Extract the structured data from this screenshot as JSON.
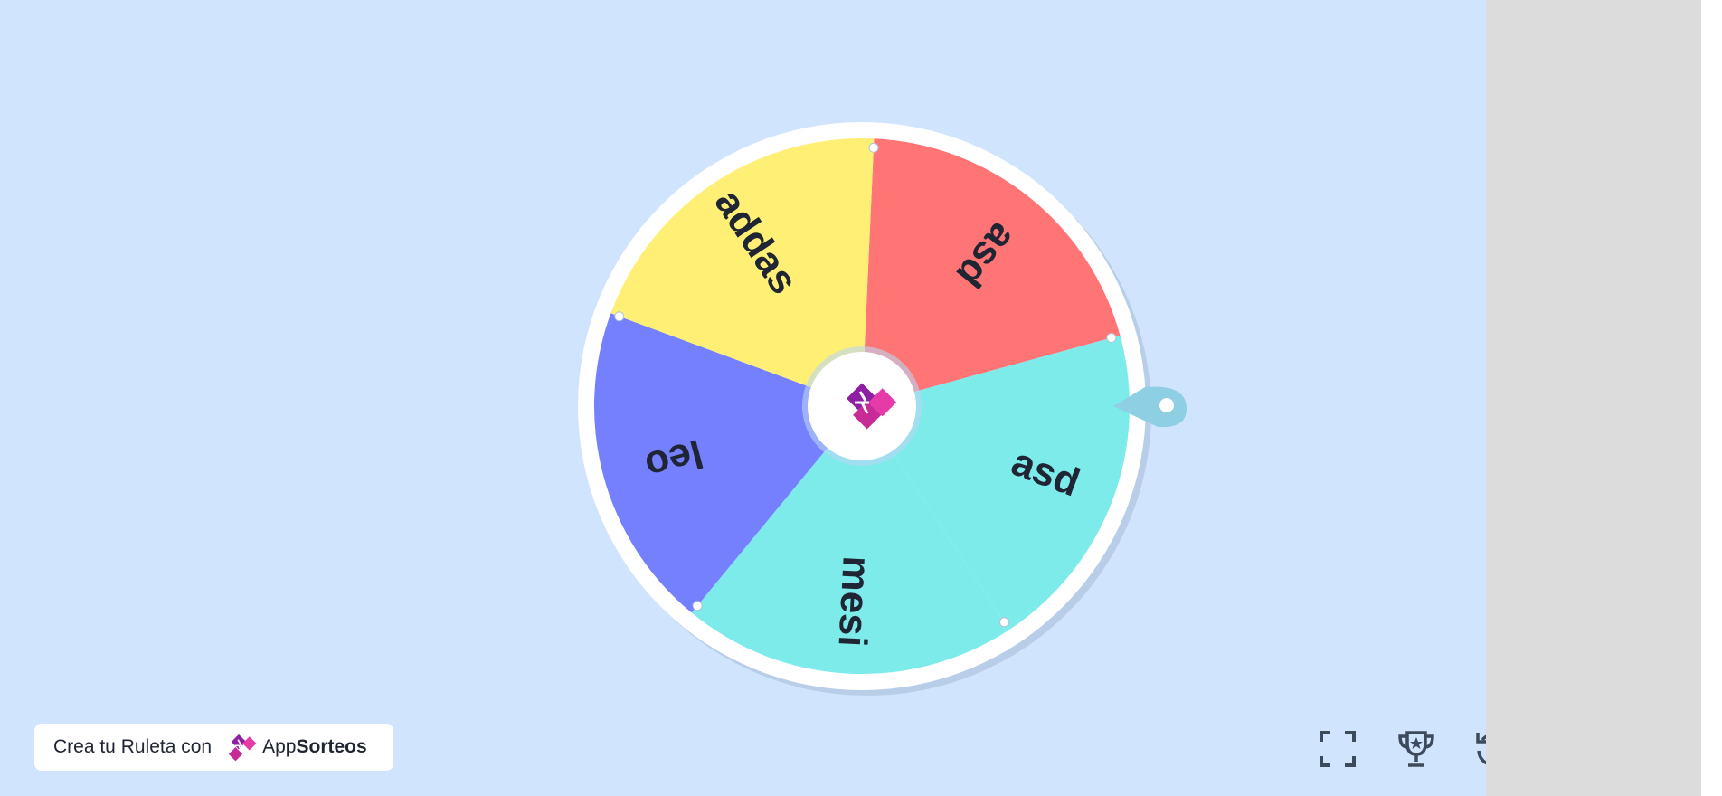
{
  "colors": {
    "background": "#d1e4fe",
    "side_panel": "#dcdcdc",
    "wheel_rim": "#ffffff",
    "pointer": "#8fcfe3",
    "icon": "#3d4a5c",
    "brand_purple": "#8e1fa3",
    "brand_pink": "#e63aa8"
  },
  "wheel": {
    "segments": [
      {
        "label": "asd",
        "color": "#ff7575"
      },
      {
        "label": "asd",
        "color": "#7eebeb"
      },
      {
        "label": "mesi",
        "color": "#7eebeb"
      },
      {
        "label": "leo",
        "color": "#7580ff"
      },
      {
        "label": "addas",
        "color": "#fff075"
      }
    ],
    "center_icon": "appsorteos-logo-icon",
    "pointer_icon": "wheel-pointer"
  },
  "brand_card": {
    "cta": "Crea tu Ruleta con",
    "brand_light": "App",
    "brand_bold": "Sorteos",
    "logo_icon": "appsorteos-logo-icon"
  },
  "controls": [
    {
      "name": "fullscreen-button",
      "icon": "fullscreen-icon"
    },
    {
      "name": "winners-button",
      "icon": "trophy-icon"
    },
    {
      "name": "reset-button",
      "icon": "reset-icon"
    },
    {
      "name": "sound-button",
      "icon": "speaker-icon"
    },
    {
      "name": "close-button",
      "icon": "close-icon"
    }
  ]
}
